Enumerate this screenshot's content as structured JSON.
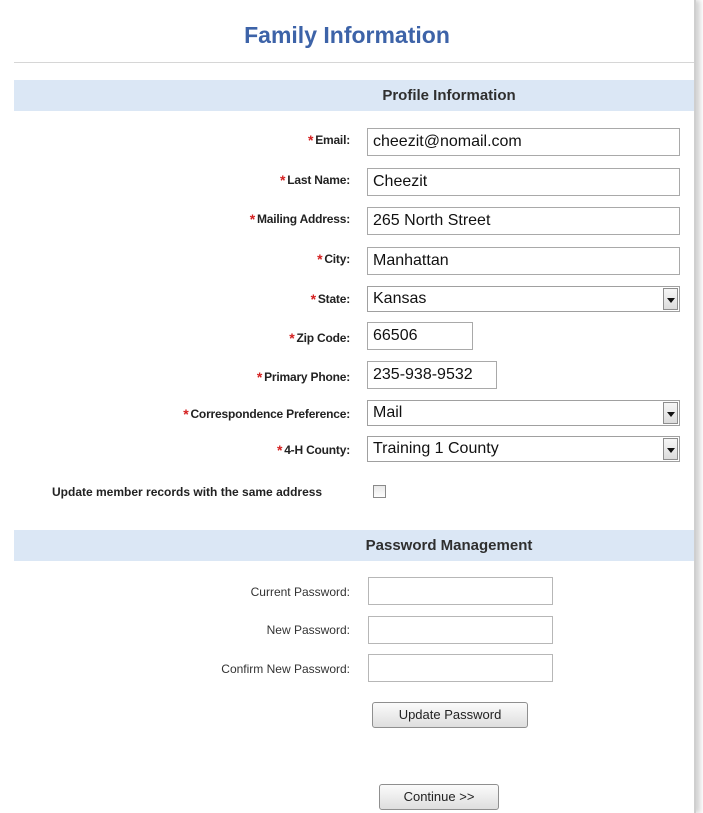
{
  "page_title": "Family Information",
  "profile": {
    "heading": "Profile Information",
    "fields": {
      "email": {
        "label": "Email:",
        "value": "cheezit@nomail.com"
      },
      "last_name": {
        "label": "Last Name:",
        "value": "Cheezit"
      },
      "mailing_address": {
        "label": "Mailing Address:",
        "value": "265 North Street"
      },
      "city": {
        "label": "City:",
        "value": "Manhattan"
      },
      "state": {
        "label": "State:",
        "value": "Kansas"
      },
      "zip": {
        "label": "Zip Code:",
        "value": "66506"
      },
      "phone": {
        "label": "Primary Phone:",
        "value": "235-938-9532"
      },
      "correspondence": {
        "label": "Correspondence Preference:",
        "value": "Mail"
      },
      "county": {
        "label": "4-H County:",
        "value": "Training 1 County"
      }
    },
    "update_records_label": "Update member records with the same address",
    "update_records_checked": false,
    "required_marker": "*"
  },
  "password": {
    "heading": "Password Management",
    "current_label": "Current Password:",
    "new_label": "New Password:",
    "confirm_label": "Confirm New Password:",
    "update_button": "Update Password"
  },
  "continue_button": "Continue >>",
  "colors": {
    "title": "#3d63a8",
    "section_bg": "#dbe7f5",
    "required": "#d42020"
  }
}
